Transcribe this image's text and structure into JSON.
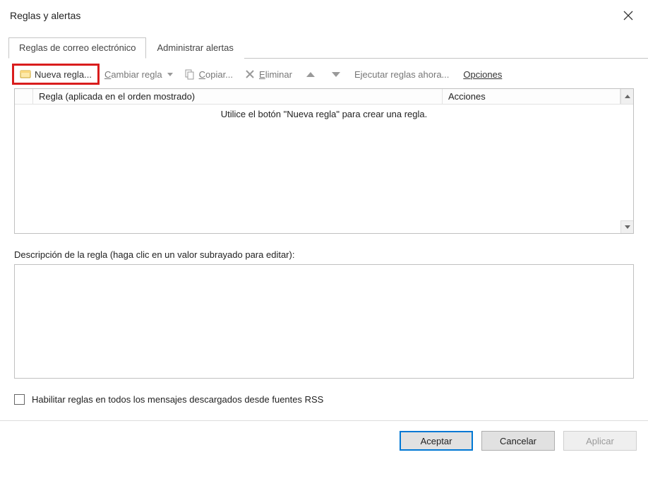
{
  "window": {
    "title": "Reglas y alertas"
  },
  "tabs": {
    "rules": "Reglas de correo electrónico",
    "alerts": "Administrar alertas"
  },
  "toolbar": {
    "new_rule": "Nueva regla...",
    "change_rule_prefix": "C",
    "change_rule_rest": "ambiar regla",
    "copy_prefix": "C",
    "copy_rest": "opiar...",
    "delete_prefix": "E",
    "delete_rest": "liminar",
    "run_now": "Ejecutar reglas ahora...",
    "options_prefix": "O",
    "options_rest": "pciones"
  },
  "list": {
    "col_rule": "Regla (aplicada en el orden mostrado)",
    "col_actions": "Acciones",
    "empty": "Utilice el botón \"Nueva regla\" para crear una regla."
  },
  "description": {
    "label": "Descripción de la regla (haga clic en un valor subrayado para editar):"
  },
  "rss": {
    "label": "Habilitar reglas en todos los mensajes descargados desde fuentes RSS"
  },
  "buttons": {
    "ok": "Aceptar",
    "cancel": "Cancelar",
    "apply": "Aplicar"
  }
}
